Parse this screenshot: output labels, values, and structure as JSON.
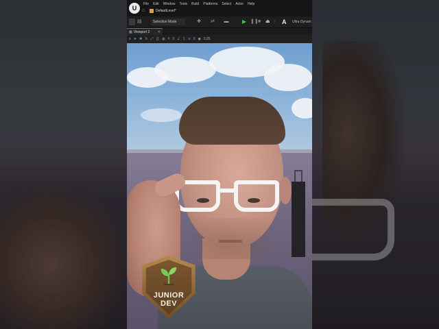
{
  "editor": {
    "menu": [
      "File",
      "Edit",
      "Window",
      "Tools",
      "Build",
      "Platforms",
      "Select",
      "Actor",
      "Help"
    ],
    "level_tab": "DefaultLevel*",
    "toolbar": {
      "selection_mode": "Selection Mode",
      "ultra_dynamic": "Ultra Dynam"
    },
    "viewport_tab": "Viewport 2",
    "viewport_toolbar": {
      "grid_value": "0",
      "angle_value": "1",
      "scale_value": "0",
      "camera_speed": "0.25"
    }
  },
  "badge": {
    "line1": "JUNIOR",
    "line2": "DEV"
  },
  "colors": {
    "accent_blue": "#3a7bd5",
    "play_green": "#3ec04a",
    "badge_bronze": "#8a6434"
  }
}
